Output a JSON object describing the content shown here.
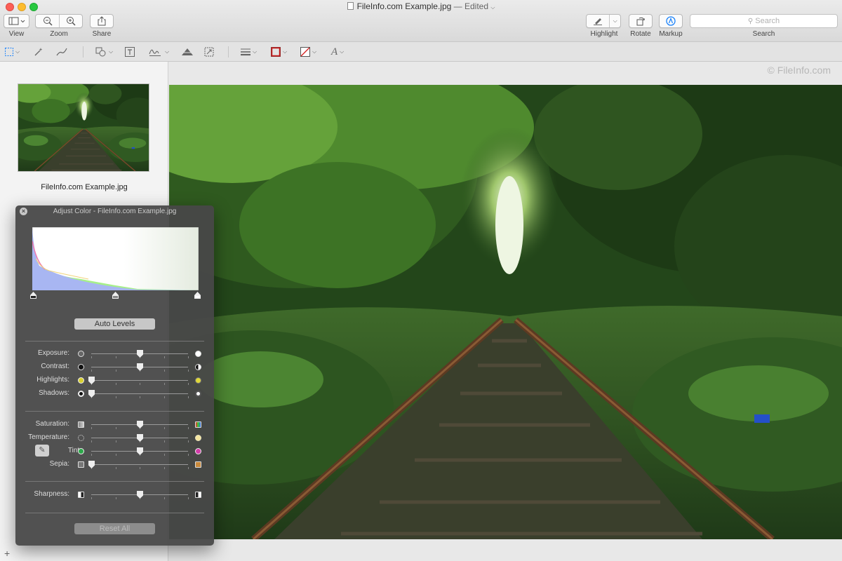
{
  "window": {
    "title": "FileInfo.com Example.jpg",
    "edited_suffix": "— Edited"
  },
  "toolbar": {
    "view_label": "View",
    "zoom_label": "Zoom",
    "share_label": "Share",
    "highlight_label": "Highlight",
    "rotate_label": "Rotate",
    "markup_label": "Markup",
    "search_placeholder": "Search",
    "search_label": "Search"
  },
  "sidebar": {
    "thumbnail_name": "FileInfo.com Example.jpg"
  },
  "canvas": {
    "watermark": "© FileInfo.com"
  },
  "adjust_color": {
    "title": "Adjust Color - FileInfo.com Example.jpg",
    "auto_levels": "Auto Levels",
    "reset_all": "Reset All",
    "sliders": [
      {
        "label": "Exposure:",
        "value": 0.5
      },
      {
        "label": "Contrast:",
        "value": 0.5
      },
      {
        "label": "Highlights:",
        "value": 0.0
      },
      {
        "label": "Shadows:",
        "value": 0.0
      },
      {
        "label": "Saturation:",
        "value": 0.5
      },
      {
        "label": "Temperature:",
        "value": 0.5
      },
      {
        "label": "Tint:",
        "value": 0.5
      },
      {
        "label": "Sepia:",
        "value": 0.0
      },
      {
        "label": "Sharpness:",
        "value": 0.5
      }
    ]
  },
  "colors": {
    "panel_bg": "#484848",
    "close_red": "#fc5f57",
    "minimize_yellow": "#fdbc2e",
    "zoom_green": "#28c840",
    "markup_accent": "#1a82fb"
  }
}
